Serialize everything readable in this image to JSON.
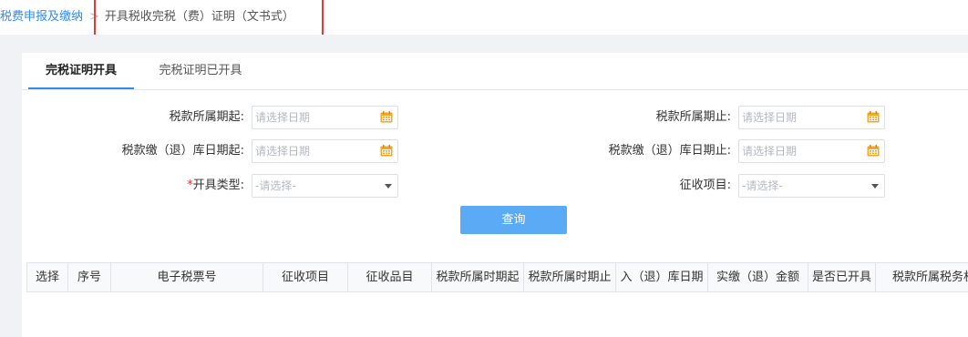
{
  "breadcrumb": {
    "parent": "税费申报及缴纳",
    "separator": ">",
    "current": "开具税收完税（费）证明（文书式）"
  },
  "tabs": [
    {
      "label": "完税证明开具",
      "active": true
    },
    {
      "label": "完税证明已开具",
      "active": false
    }
  ],
  "form": {
    "tax_period_start": {
      "label": "税款所属期起:",
      "placeholder": "请选择日期",
      "icon": "calendar-icon"
    },
    "tax_period_end": {
      "label": "税款所属期止:",
      "placeholder": "请选择日期",
      "icon": "calendar-icon"
    },
    "storage_date_start": {
      "label": "税款缴（退）库日期起:",
      "placeholder": "请选择日期",
      "icon": "calendar-icon"
    },
    "storage_date_end": {
      "label": "税款缴（退）库日期止:",
      "placeholder": "请选择日期",
      "icon": "calendar-icon"
    },
    "issue_type": {
      "required_mark": "*",
      "label": "开具类型:",
      "value": "-请选择-"
    },
    "levy_item": {
      "label": "征收项目:",
      "value": "-请选择-"
    }
  },
  "buttons": {
    "query": "查询"
  },
  "table": {
    "columns": [
      "选择",
      "序号",
      "电子税票号",
      "征收项目",
      "征收品目",
      "税款所属时期起",
      "税款所属时期止",
      "入（退）库日期",
      "实缴（退）金额",
      "是否已开具",
      "税款所属税务机"
    ]
  },
  "colors": {
    "accent": "#2d8cf0",
    "query_button": "#5aaaf5",
    "highlight_box": "#e53935",
    "calendar_icon": "#f5a623"
  }
}
